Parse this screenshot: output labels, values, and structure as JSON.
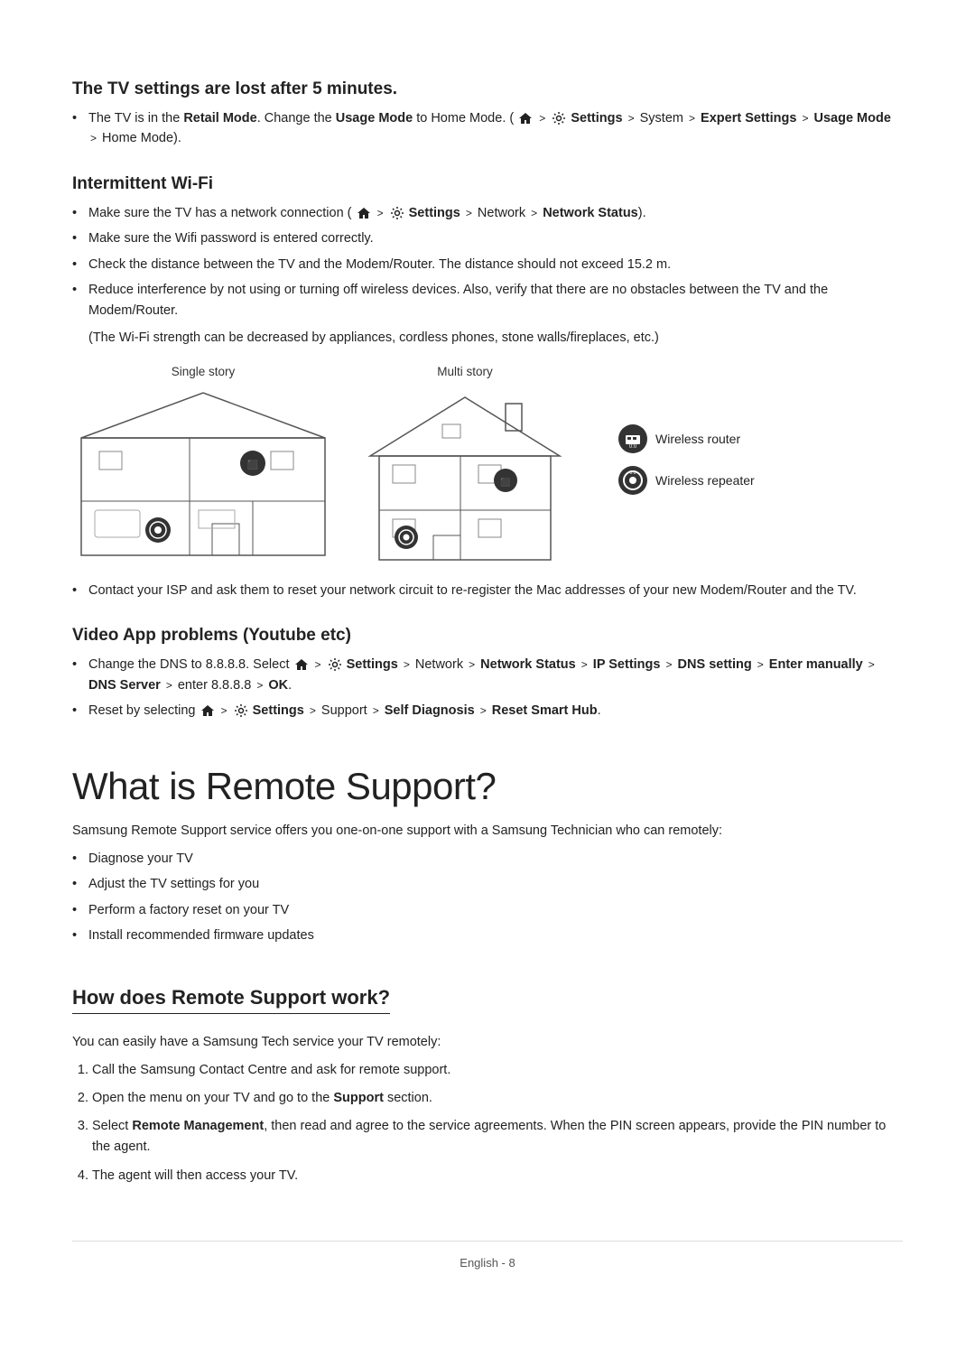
{
  "sections": {
    "tv_settings": {
      "heading": "The TV settings are lost after 5 minutes.",
      "bullets": [
        {
          "text_parts": [
            {
              "text": "The TV is in the ",
              "style": "normal"
            },
            {
              "text": "Retail Mode",
              "style": "bold"
            },
            {
              "text": ". Change the ",
              "style": "normal"
            },
            {
              "text": "Usage Mode",
              "style": "bold"
            },
            {
              "text": " to Home Mode. (",
              "style": "normal"
            },
            {
              "text": "home_icon",
              "style": "icon"
            },
            {
              "text": " > ",
              "style": "arrow"
            },
            {
              "text": "settings_icon",
              "style": "icon"
            },
            {
              "text": " Settings",
              "style": "bold"
            },
            {
              "text": " > System > ",
              "style": "normal"
            },
            {
              "text": "Expert Settings",
              "style": "bold"
            },
            {
              "text": " > ",
              "style": "normal"
            },
            {
              "text": "Usage Mode",
              "style": "bold"
            },
            {
              "text": " > Home Mode).",
              "style": "normal"
            }
          ]
        }
      ]
    },
    "intermittent_wifi": {
      "heading": "Intermittent Wi-Fi",
      "bullets": [
        "Make sure the TV has a network connection (home_icon > settings_icon Settings > Network > Network Status).",
        "Make sure the Wifi password is entered correctly.",
        "Check the distance between the TV and the Modem/Router. The distance should not exceed 15.2 m.",
        "Reduce interference by not using or turning off wireless devices. Also, verify that there are no obstacles between the TV and the Modem/Router.",
        "wifi_note"
      ],
      "wifi_note": "(The Wi-Fi strength can be decreased by appliances, cordless phones, stone walls/fireplaces, etc.)",
      "diagram": {
        "single_story_label": "Single story",
        "multi_story_label": "Multi story"
      },
      "after_diagram": "Contact your ISP and ask them to reset your network circuit to re-register the Mac addresses of your new Modem/Router and the TV.",
      "legend": {
        "wireless_router": "Wireless router",
        "wireless_repeater": "Wireless repeater"
      }
    },
    "video_app": {
      "heading": "Video App problems (Youtube etc)",
      "bullets": [
        {
          "id": "dns",
          "text": "Change the DNS to 8.8.8.8. Select home_icon > settings_icon Settings > Network > Network Status > IP Settings > DNS setting > Enter manually > DNS Server > enter 8.8.8.8 > OK."
        },
        {
          "id": "reset",
          "text": "Reset by selecting home_icon > settings_icon Settings > Support > Self Diagnosis > Reset Smart Hub."
        }
      ]
    },
    "remote_support": {
      "heading": "What is Remote Support?",
      "intro": "Samsung Remote Support service offers you one-on-one support with a Samsung Technician who can remotely:",
      "bullets": [
        "Diagnose your TV",
        "Adjust the TV settings for you",
        "Perform a factory reset on your TV",
        "Install recommended firmware updates"
      ]
    },
    "how_does": {
      "heading": "How does Remote Support work?",
      "intro": "You can easily have a Samsung Tech service your TV remotely:",
      "steps": [
        "Call the Samsung Contact Centre and ask for remote support.",
        "Open the menu on your TV and go to the Support section.",
        "Select Remote Management, then read and agree to the service agreements. When the PIN screen appears, provide the PIN number to the agent.",
        "The agent will then access your TV."
      ]
    }
  },
  "footer": {
    "text": "English - 8"
  }
}
